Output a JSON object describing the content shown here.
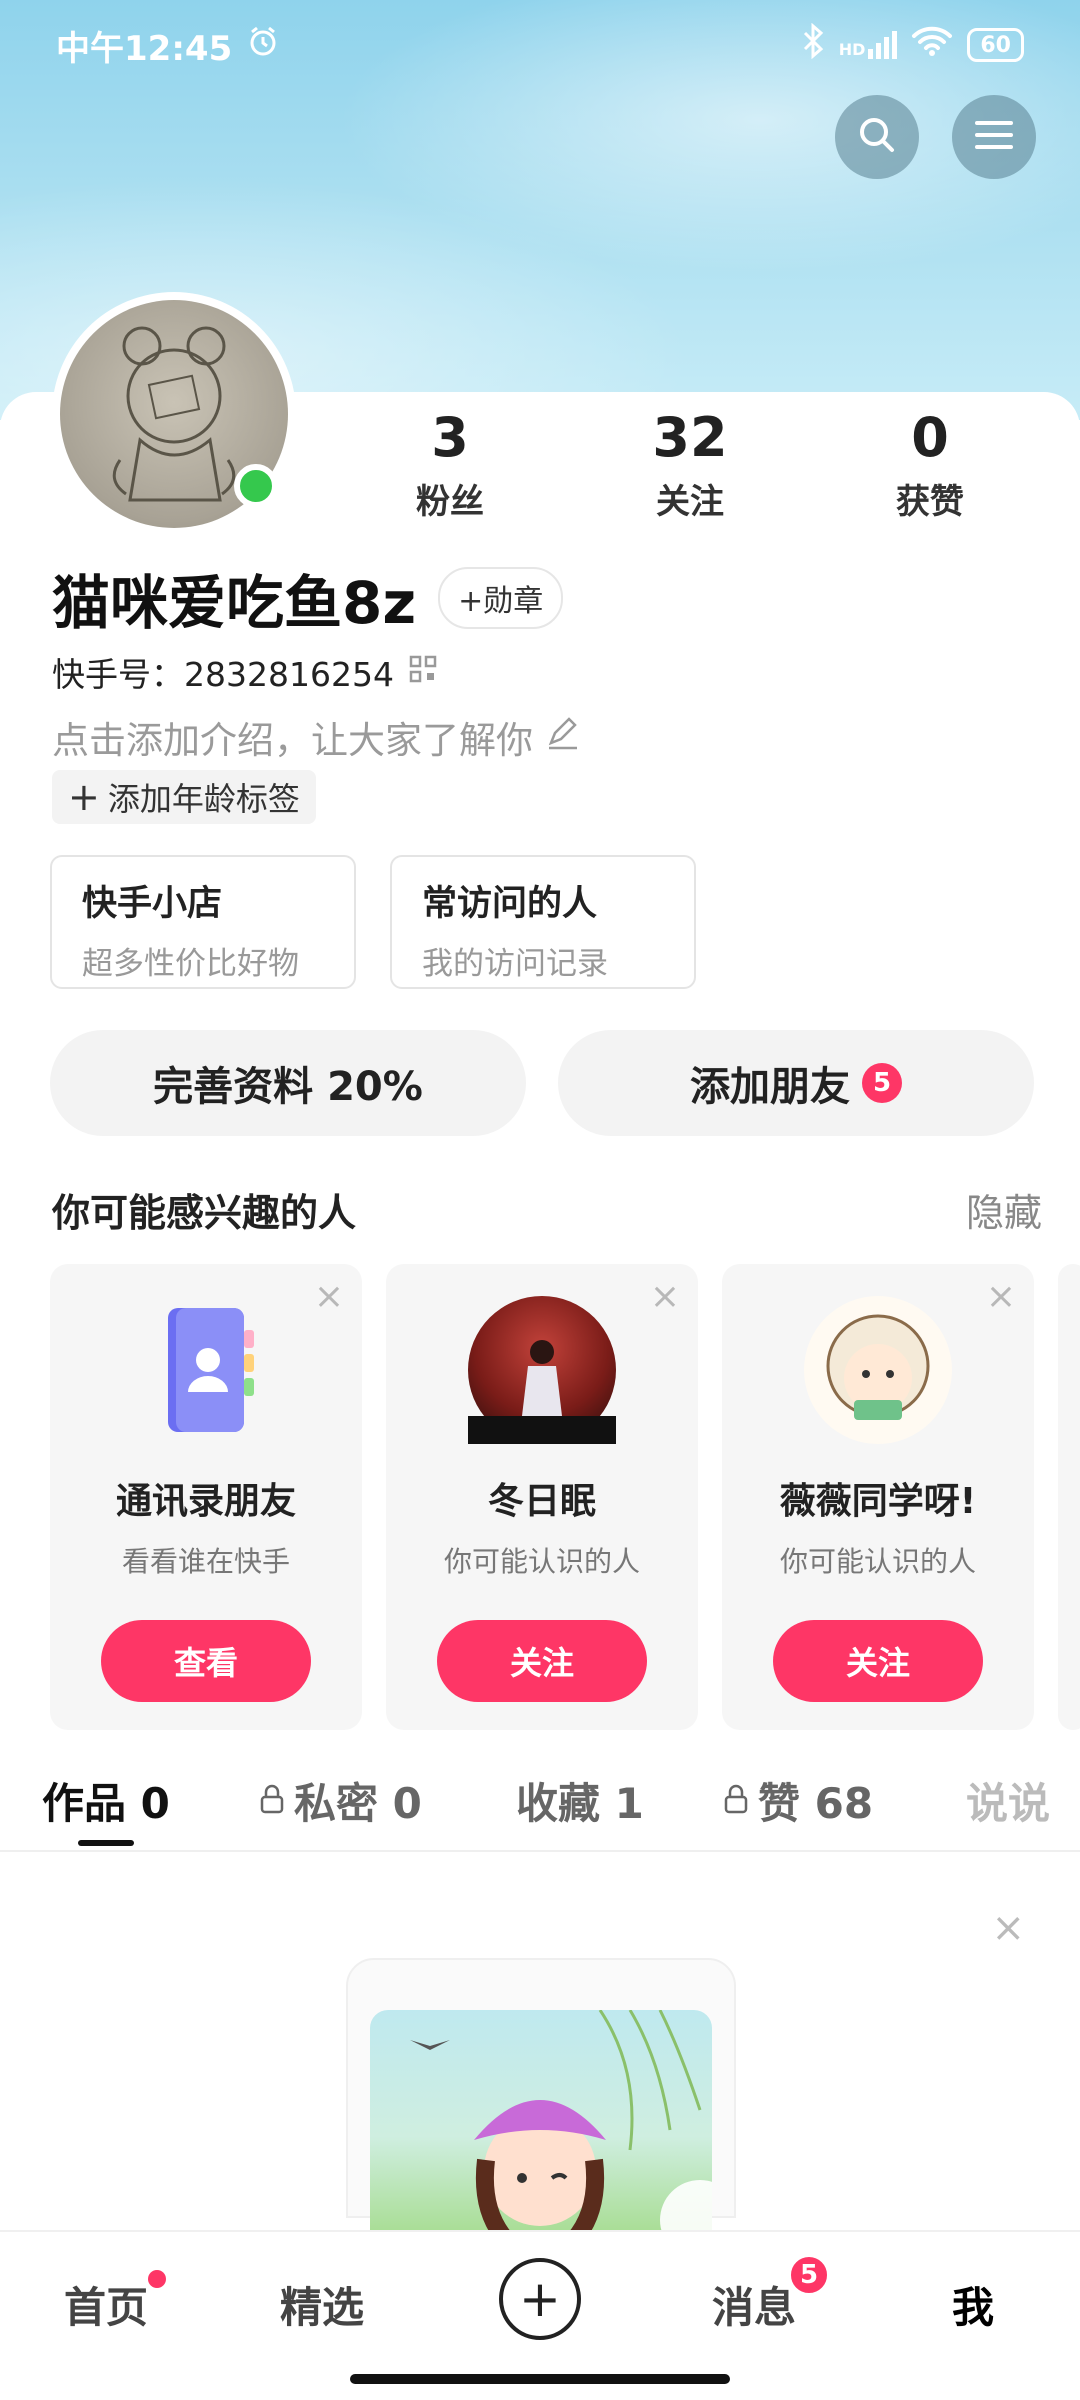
{
  "status_bar": {
    "time": "中午12:45",
    "battery": "60",
    "signal_label": "HD"
  },
  "profile": {
    "username": "猫咪爱吃鱼8z",
    "badge_label": "+勋章",
    "kuaishou_id": "快手号：2832816254",
    "intro_placeholder": "点击添加介绍，让大家了解你",
    "age_tag": "添加年龄标签",
    "online": true
  },
  "stats": [
    {
      "value": "3",
      "label": "粉丝"
    },
    {
      "value": "32",
      "label": "关注"
    },
    {
      "value": "0",
      "label": "获赞"
    }
  ],
  "entries": [
    {
      "title": "快手小店",
      "subtitle": "超多性价比好物"
    },
    {
      "title": "常访问的人",
      "subtitle": "我的访问记录"
    }
  ],
  "actions": {
    "complete_profile": "完善资料 20%",
    "add_friends": "添加朋友",
    "add_friends_badge": "5"
  },
  "suggestions": {
    "title": "你可能感兴趣的人",
    "hide_label": "隐藏",
    "cards": [
      {
        "name": "通讯录朋友",
        "desc": "看看谁在快手",
        "button": "查看"
      },
      {
        "name": "冬日眠",
        "desc": "你可能认识的人",
        "button": "关注"
      },
      {
        "name": "薇薇同学呀!",
        "desc": "你可能认识的人",
        "button": "关注"
      }
    ]
  },
  "tabs": [
    {
      "label": "作品 0",
      "locked": false,
      "active": true
    },
    {
      "label": "私密 0",
      "locked": true,
      "active": false
    },
    {
      "label": "收藏 1",
      "locked": false,
      "active": false
    },
    {
      "label": "赞 68",
      "locked": true,
      "active": false
    },
    {
      "label": "说说",
      "locked": false,
      "active": false
    }
  ],
  "bottom_nav": {
    "items": [
      {
        "label": "首页",
        "dot": true
      },
      {
        "label": "精选"
      },
      {
        "label": "消息",
        "count": "5"
      },
      {
        "label": "我",
        "active": true
      }
    ]
  },
  "colors": {
    "accent": "#fe3666",
    "online": "#35c84d",
    "sky": "#a9def0"
  }
}
